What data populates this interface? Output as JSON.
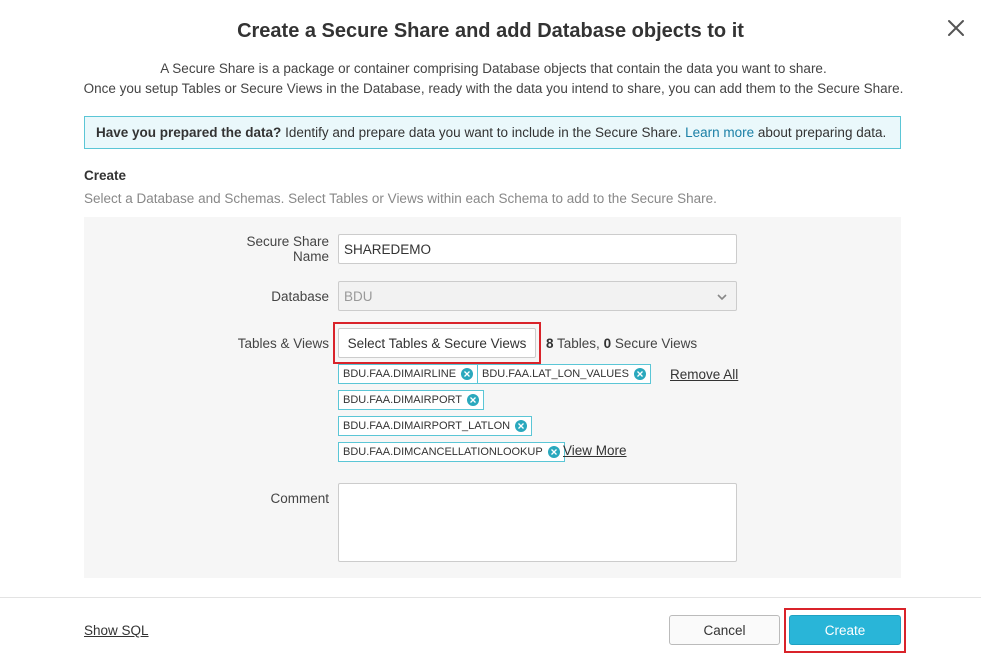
{
  "dialog": {
    "title": "Create a Secure Share and add Database objects to it",
    "intro_line1": "A Secure Share is a package or container comprising Database objects that contain the data you want to share.",
    "intro_line2": "Once you setup Tables or Secure Views in the Database, ready with the data you intend to share, you can add them to the Secure Share."
  },
  "info": {
    "bold": "Have you prepared the data?",
    "text1": " Identify and prepare data you want to include in the Secure Share. ",
    "link": "Learn more",
    "text2": " about preparing data."
  },
  "section": {
    "title": "Create",
    "description": "Select a Database and Schemas. Select Tables or Views within each Schema to add to the Secure Share."
  },
  "form": {
    "share_name_label_1": "Secure Share",
    "share_name_label_2": "Name",
    "share_name_value": "SHAREDEMO",
    "database_label": "Database",
    "database_value": "BDU",
    "tables_label": "Tables & Views",
    "select_button": "Select Tables & Secure Views",
    "tables_count": "8",
    "tables_text": " Tables, ",
    "views_count": "0",
    "views_text": " Secure Views",
    "chips": [
      "BDU.FAA.DIMAIRLINE",
      "BDU.FAA.LAT_LON_VALUES",
      "BDU.FAA.DIMAIRPORT",
      "BDU.FAA.DIMAIRPORT_LATLON",
      "BDU.FAA.DIMCANCELLATIONLOOKUP"
    ],
    "remove_all": "Remove All",
    "view_more": "View More",
    "comment_label": "Comment"
  },
  "footer": {
    "show_sql": "Show SQL",
    "cancel": "Cancel",
    "create": "Create"
  },
  "colors": {
    "accent": "#29b5d8",
    "highlight": "#d9232a"
  }
}
